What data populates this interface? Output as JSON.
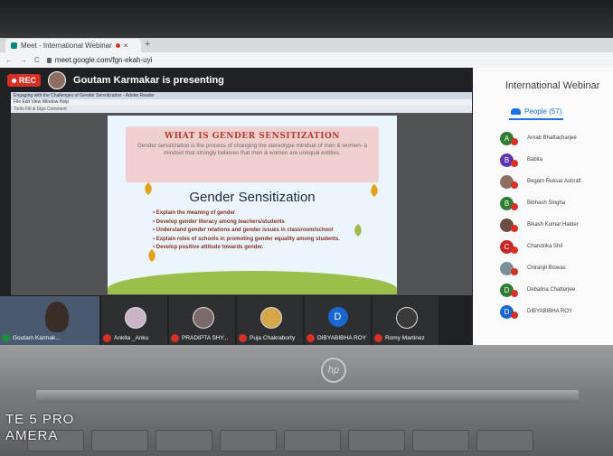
{
  "browser": {
    "tab_title": "Meet - International Webinar",
    "tab_close": "×",
    "new_tab": "+",
    "nav_back": "←",
    "nav_forward": "→",
    "reload": "C",
    "url": "meet.google.com/fgn-ekah-uyi"
  },
  "meet": {
    "rec_label": "REC",
    "presenting_text": "Goutam Karmakar is presenting"
  },
  "shared_app": {
    "title": "Engaging with the Challenges of Gender Sensitization - Adobe Reader",
    "menu": "File  Edit  View  Window  Help",
    "toolbar_zoom": "Tools   Fill & Sign   Comment"
  },
  "slide": {
    "heading": "WHAT IS GENDER SENSITIZATION",
    "subtext": "Gender sensitization is the process of changing the stereotype mindset of men & women- a mindset that strongly believes that men & women are unequal entities.",
    "title": "Gender Sensitization",
    "bullets": [
      "Explain the meaning of gender",
      "Develop gender literacy among teachers/students",
      "Understand gender relations and gender issues in classroom/school",
      "Explain roles of schools in promoting gender equality among students.",
      "Develop positive attitude towards gender."
    ]
  },
  "tiles": [
    {
      "name": "Goutam Karmak...",
      "avatar": ""
    },
    {
      "name": "Ankita _Anku",
      "avatar": ""
    },
    {
      "name": "PRADIPTA SHY...",
      "avatar": ""
    },
    {
      "name": "Puja Chakraborty",
      "avatar": ""
    },
    {
      "name": "DIBYABIBHA ROY",
      "avatar": "D"
    },
    {
      "name": "Romy Martinez",
      "avatar": ""
    }
  ],
  "panel": {
    "title": "International Webinar",
    "people_tab": "People (57)",
    "participants": [
      {
        "name": "Arnab Bhattacharjee",
        "initial": "A",
        "color": "#2e7d32"
      },
      {
        "name": "Babita",
        "initial": "B",
        "color": "#5e35b1"
      },
      {
        "name": "Begam Ruksar Ashrafi",
        "initial": "",
        "color": "#8d6e63"
      },
      {
        "name": "Bibhash Singha",
        "initial": "B",
        "color": "#2e7d32"
      },
      {
        "name": "Bikash Kumar Halder",
        "initial": "",
        "color": "#6d4c41"
      },
      {
        "name": "Chandrika Shil",
        "initial": "C",
        "color": "#c62828"
      },
      {
        "name": "Chiranjit Biswas",
        "initial": "",
        "color": "#78909c"
      },
      {
        "name": "Debalina Chatterjee",
        "initial": "D",
        "color": "#2e7d32"
      },
      {
        "name": "DIBYABIBHA ROY",
        "initial": "D",
        "color": "#1967d2"
      }
    ]
  },
  "device": {
    "watermark_line1": "TE 5 PRO",
    "watermark_line2": "AMERA",
    "logo": "hp"
  }
}
